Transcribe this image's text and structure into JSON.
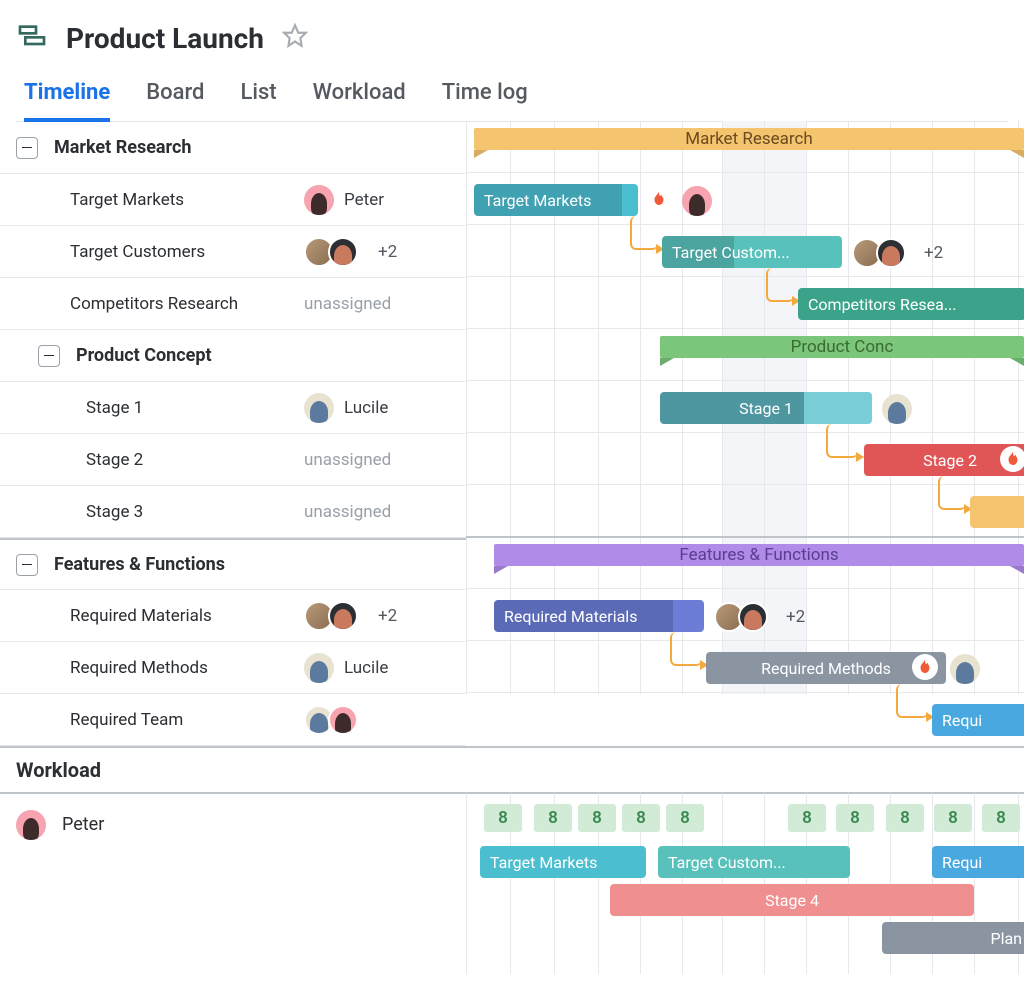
{
  "header": {
    "title": "Product Launch"
  },
  "tabs": [
    "Timeline",
    "Board",
    "List",
    "Workload",
    "Time log"
  ],
  "active_tab": 0,
  "groups": [
    {
      "name": "Market Research",
      "bar_color": "orange",
      "tasks": [
        {
          "name": "Target Markets",
          "assignee": "Peter",
          "assignee_avatar": "peter",
          "bar_label": "Target Markets",
          "bar_color": "teal",
          "flame": true,
          "right_avatar_single": "peter"
        },
        {
          "name": "Target Customers",
          "assignee_stack": true,
          "plus": "+2",
          "bar_label": "Target Custom...",
          "bar_color": "teal2",
          "flame": false,
          "right_stack": true,
          "right_plus": "+2"
        },
        {
          "name": "Competitors Research",
          "unassigned": "unassigned",
          "bar_label": "Competitors Resea...",
          "bar_color": "green2"
        }
      ],
      "subgroups": [
        {
          "name": "Product Concept",
          "bar_color": "green",
          "bar_label": "Product Conc",
          "tasks": [
            {
              "name": "Stage 1",
              "assignee": "Lucile",
              "assignee_avatar": "lucile",
              "bar_label": "Stage 1",
              "bar_color": "dark-teal",
              "right_avatar_single": "lucile"
            },
            {
              "name": "Stage 2",
              "unassigned": "unassigned",
              "bar_label": "Stage 2",
              "bar_color": "red",
              "flame": true
            },
            {
              "name": "Stage 3",
              "unassigned": "unassigned",
              "bar_color": "orange"
            }
          ]
        }
      ]
    },
    {
      "name": "Features & Functions",
      "bar_color": "purple",
      "tasks": [
        {
          "name": "Required Materials",
          "assignee_stack": true,
          "plus": "+2",
          "bar_label": "Required Materials",
          "bar_color": "indigo",
          "right_stack": true,
          "right_plus": "+2"
        },
        {
          "name": "Required Methods",
          "assignee": "Lucile",
          "assignee_avatar": "lucile",
          "bar_label": "Required Methods",
          "bar_color": "gray",
          "flame": true,
          "right_avatar_single": "lucile"
        },
        {
          "name": "Required Team",
          "assignee_stack_lucile_peter": true,
          "bar_label": "Requi",
          "bar_color": "blue"
        }
      ]
    }
  ],
  "workload": {
    "title": "Workload",
    "person": "Peter",
    "hours": [
      "8",
      "8",
      "8",
      "8",
      "8",
      "8",
      "8",
      "8",
      "8",
      "8"
    ],
    "bars": [
      {
        "label": "Target Markets",
        "color": "teal"
      },
      {
        "label": "Target Custom...",
        "color": "teal2"
      },
      {
        "label": "Requi",
        "color": "blue"
      },
      {
        "label": "Stage 4",
        "color": "#f08f8f"
      },
      {
        "label": "Plan",
        "color": "gray"
      }
    ]
  }
}
